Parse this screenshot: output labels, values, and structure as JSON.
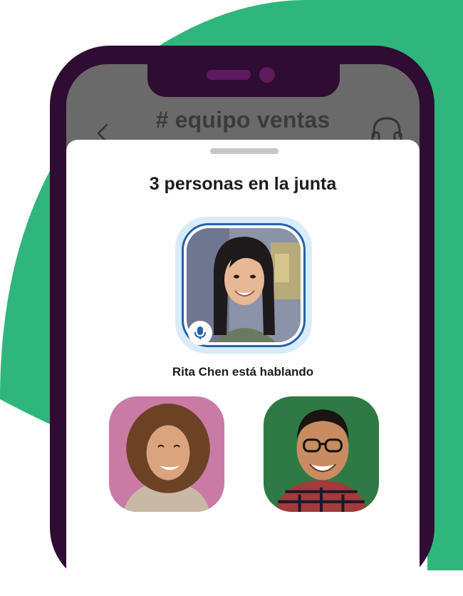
{
  "channel": {
    "title": "# equipo ventas"
  },
  "huddle": {
    "title": "3 personas en la junta",
    "speaking_label": "Rita Chen está hablando",
    "participants": [
      {
        "role": "active-speaker"
      },
      {
        "role": "participant"
      },
      {
        "role": "participant"
      }
    ]
  },
  "icons": {
    "back": "chevron-left-icon",
    "headphones": "headphones-icon",
    "mic": "microphone-icon"
  },
  "colors": {
    "background_accent": "#2fb67c",
    "phone_frame": "#2f0c31",
    "speaking_ring": "#2463a8",
    "speaking_glow": "#d8ecf9"
  }
}
